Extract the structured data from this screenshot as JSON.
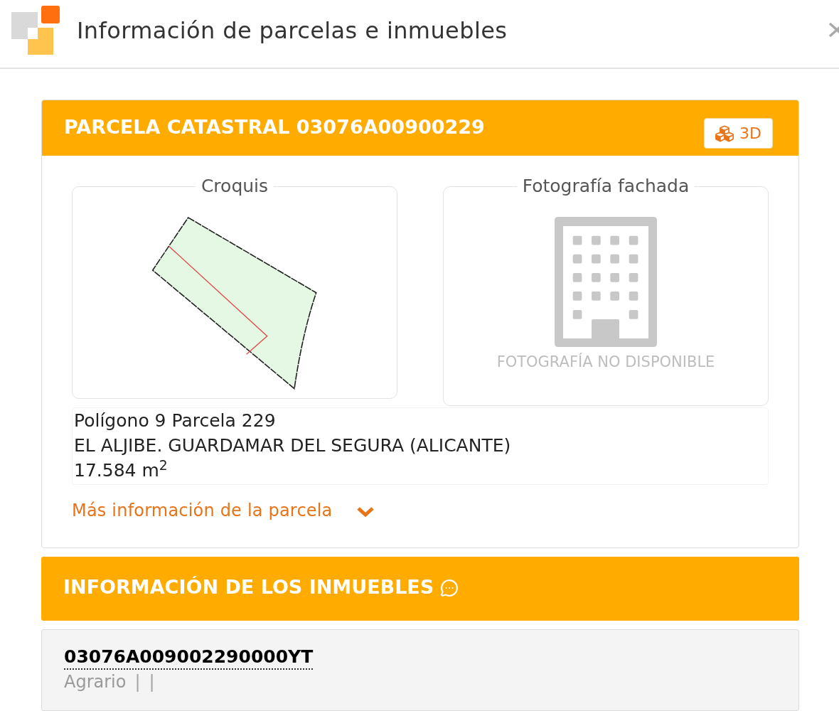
{
  "header": {
    "title": "Información de parcelas e inmuebles"
  },
  "parcel_card": {
    "title": "PARCELA CATASTRAL 03076A00900229",
    "view_3d_button": "3D",
    "sketch_panel": {
      "title": "Croquis"
    },
    "photo_panel": {
      "title": "Fotografía fachada",
      "no_photo_text": "FOTOGRAFÍA NO DISPONIBLE"
    },
    "details": [
      "Polígono 9 Parcela 229",
      "EL ALJIBE. GUARDAMAR DEL SEGURA (ALICANTE)",
      "17.584 m$^{2}$"
    ],
    "more_info_link": {
      "label": "Más información de la parcela",
      "expanded": false
    }
  },
  "properties_card": {
    "title": "INFORMACIÓN DE LOS INMUEBLES",
    "items": [
      {
        "reference": "03076A009002290000YT",
        "use": "Agrario",
        "separators": [
          "|",
          "|"
        ]
      }
    ]
  }
}
